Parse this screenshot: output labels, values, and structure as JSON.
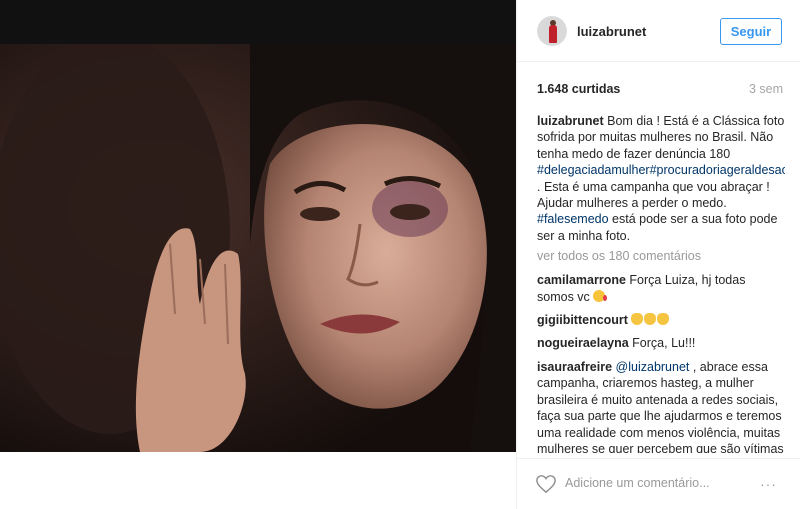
{
  "post": {
    "username": "luizabrunet",
    "follow_label": "Seguir",
    "likes": "1.648 curtidas",
    "time_ago": "3 sem",
    "caption": {
      "user": "luizabrunet",
      "text1": " Bom dia ! Está é a Clássica foto sofrida por muitas mulheres no Brasil. Não tenha medo de fazer denúncia 180 ",
      "tag1": "#delegaciadamulher",
      "tag2": "#procuradoriageraldesaopaulo",
      "text2": " . Esta é uma campanha que vou abraçar ! Ajudar mulheres a perder o medo. ",
      "tag3": "#falesemedo",
      "text3": " está pode ser a sua foto pode ser a minha foto."
    },
    "view_all": "ver todos os 180 comentários"
  },
  "comments": [
    {
      "user": "camilamarrone",
      "text": " Força Luiza, hj todas somos vc "
    },
    {
      "user": "gigiibittencourt",
      "text": " "
    },
    {
      "user": "nogueiraelayna",
      "text": " Força, Lu!!!"
    },
    {
      "user": "isauraafreire",
      "mention": "@luizabrunet",
      "text": " , abrace essa campanha, criaremos hasteg, a mulher brasileira é muito antenada a redes sociais, faça sua parte que lhe ajudarmos e teremos uma realidade com menos violência, muitas mulheres se quer percebem que são vítimas de violência,"
    }
  ],
  "footer": {
    "comment_placeholder": "Adicione um comentário...",
    "more_label": "···"
  },
  "icons": {
    "like": "heart-icon",
    "more": "more-options-icon"
  },
  "colors": {
    "accent": "#3897f0",
    "hashtag": "#003569",
    "muted": "#999999"
  }
}
